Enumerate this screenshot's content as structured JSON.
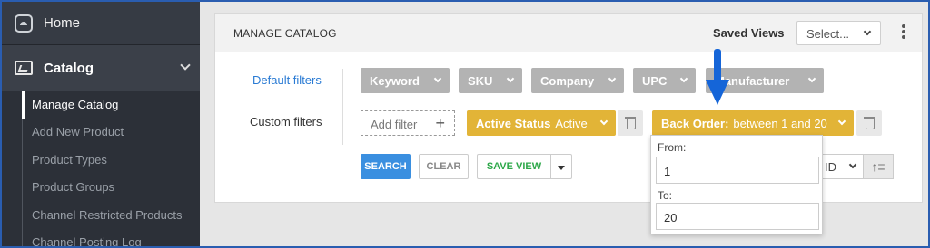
{
  "sidebar": {
    "home_label": "Home",
    "catalog_label": "Catalog",
    "items": [
      {
        "label": "Manage Catalog"
      },
      {
        "label": "Add New Product"
      },
      {
        "label": "Product Types"
      },
      {
        "label": "Product Groups"
      },
      {
        "label": "Channel Restricted Products"
      },
      {
        "label": "Channel Posting Log"
      }
    ]
  },
  "header": {
    "title": "MANAGE CATALOG",
    "saved_views_label": "Saved Views",
    "saved_views_placeholder": "Select..."
  },
  "filters": {
    "default_label": "Default filters",
    "custom_label": "Custom filters",
    "default_chips": [
      "Keyword",
      "SKU",
      "Company",
      "UPC",
      "Manufacturer"
    ],
    "add_filter_label": "Add filter",
    "add_filter_plus": "+",
    "active_status": {
      "name": "Active Status",
      "value": "Active"
    },
    "back_order": {
      "name": "Back Order:",
      "value": "between 1 and 20"
    }
  },
  "actions": {
    "search": "SEARCH",
    "clear": "CLEAR",
    "save_view": "SAVE VIEW",
    "sort_value": "ID",
    "sort_icon": "↑≡"
  },
  "range_popup": {
    "from_label": "From:",
    "from_value": "1",
    "to_label": "To:",
    "to_value": "20"
  },
  "colors": {
    "sidebar_bg": "#2c3038",
    "accent_blue": "#3a8fe0",
    "chip_gray": "#b3b3b3",
    "chip_yellow": "#e2b437",
    "save_green": "#2ea84a",
    "arrow_blue": "#1565d8"
  }
}
